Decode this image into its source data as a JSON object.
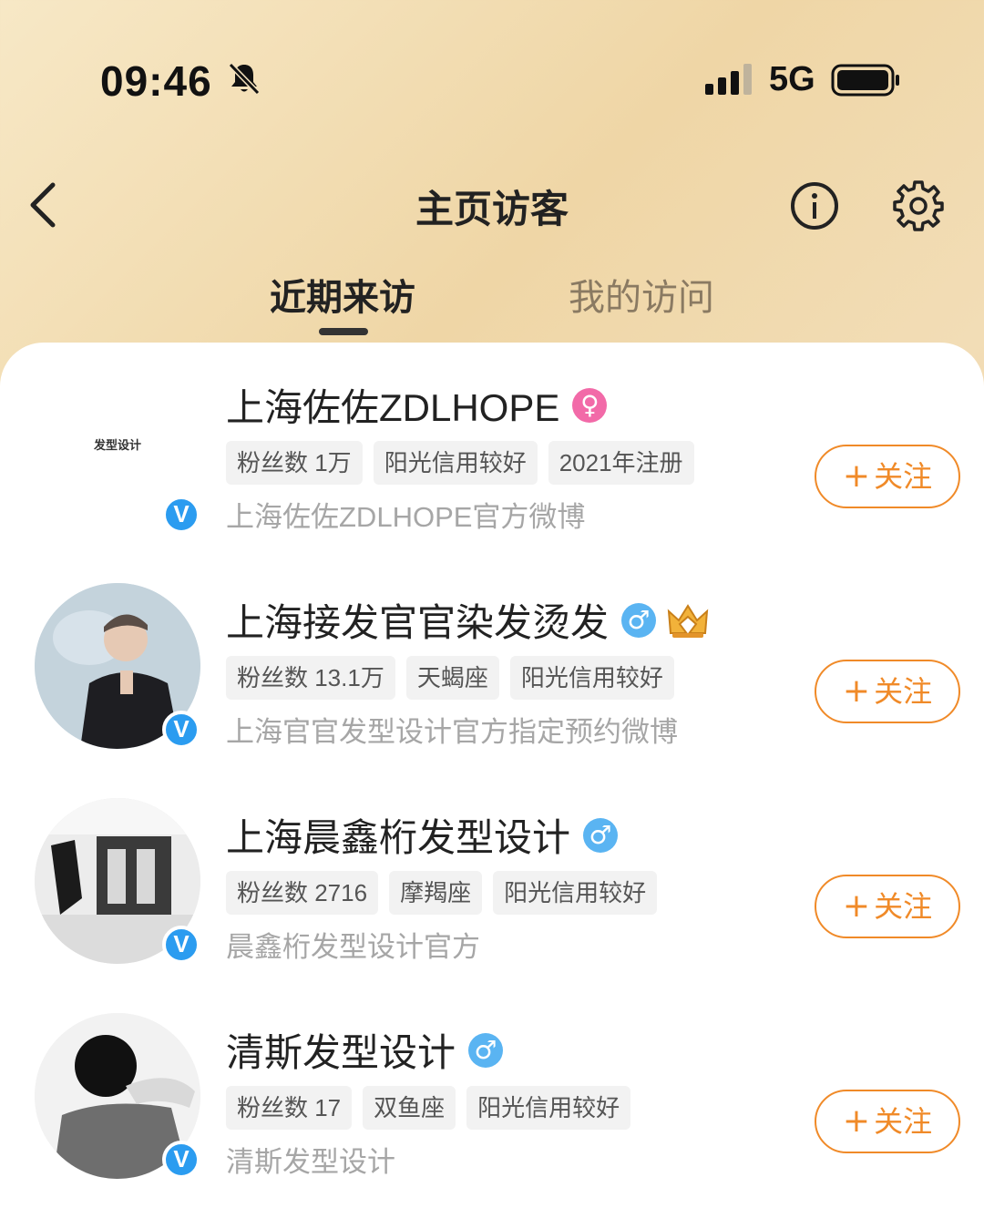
{
  "status_bar": {
    "time": "09:46",
    "network": "5G"
  },
  "nav": {
    "title": "主页访客"
  },
  "tabs": [
    {
      "label": "近期来访",
      "active": true
    },
    {
      "label": "我的访问",
      "active": false
    }
  ],
  "visitors": [
    {
      "name": "上海佐佐ZDLHOPE",
      "gender": "female",
      "avatar_text": "发型设计",
      "tags": [
        "粉丝数 1万",
        "阳光信用较好",
        "2021年注册"
      ],
      "description": "上海佐佐ZDLHOPE官方微博",
      "follow_label": "关注"
    },
    {
      "name": "上海接发官官染发烫发",
      "gender": "male",
      "tags": [
        "粉丝数 13.1万",
        "天蝎座",
        "阳光信用较好"
      ],
      "description": "上海官官发型设计官方指定预约微博",
      "follow_label": "关注"
    },
    {
      "name": "上海晨鑫桁发型设计",
      "gender": "male",
      "tags": [
        "粉丝数 2716",
        "摩羯座",
        "阳光信用较好"
      ],
      "description": "晨鑫桁发型设计官方",
      "follow_label": "关注"
    },
    {
      "name": "清斯发型设计",
      "gender": "male",
      "tags": [
        "粉丝数 17",
        "双鱼座",
        "阳光信用较好"
      ],
      "description": "清斯发型设计",
      "follow_label": "关注"
    }
  ],
  "badges": {
    "verified": "V",
    "female_symbol": "♀",
    "male_symbol": "♂",
    "plus": "+"
  },
  "colors": {
    "accent": "#f08a28",
    "verified": "#2b9cf0",
    "male": "#5ab4f2",
    "female": "#f26aa8"
  }
}
